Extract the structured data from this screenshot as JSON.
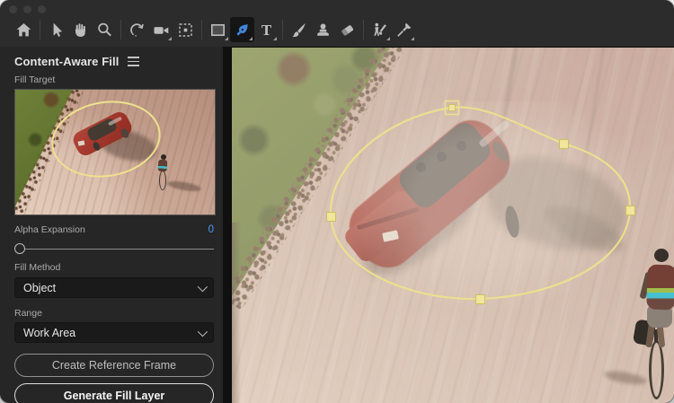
{
  "window": {
    "controls": [
      {
        "name": "close"
      },
      {
        "name": "minimize"
      },
      {
        "name": "zoom"
      }
    ]
  },
  "toolbar": {
    "tools": [
      "home",
      "selection",
      "hand",
      "zoom",
      "orbit",
      "camera",
      "pan-behind",
      "rectangle",
      "pen",
      "type",
      "brush",
      "clone-stamp",
      "eraser",
      "roto-brush",
      "puppet-pin"
    ],
    "selected_tool": "pen",
    "type_tool_glyph": "T"
  },
  "panel": {
    "title": "Content-Aware Fill",
    "fill_target_label": "Fill Target",
    "alpha_expansion": {
      "label": "Alpha Expansion",
      "value": "0"
    },
    "fill_method": {
      "label": "Fill Method",
      "value": "Object"
    },
    "range": {
      "label": "Range",
      "value": "Work Area"
    },
    "buttons": {
      "create_reference_frame": "Create Reference Frame",
      "generate_fill_layer": "Generate Fill Layer"
    }
  },
  "viewer": {
    "mask_color": "#ece08e",
    "mask_vertex_count": 5,
    "selected_vertex": "top",
    "scene": "aerial footage of a red convertible on a dirt road with a cyclist; fill mask drawn around the car"
  },
  "colors": {
    "accent_blue": "#4a9df0",
    "panel_bg": "#262626",
    "toolbar_bg": "#2c2c2c",
    "mask_yellow": "#ece08e"
  }
}
